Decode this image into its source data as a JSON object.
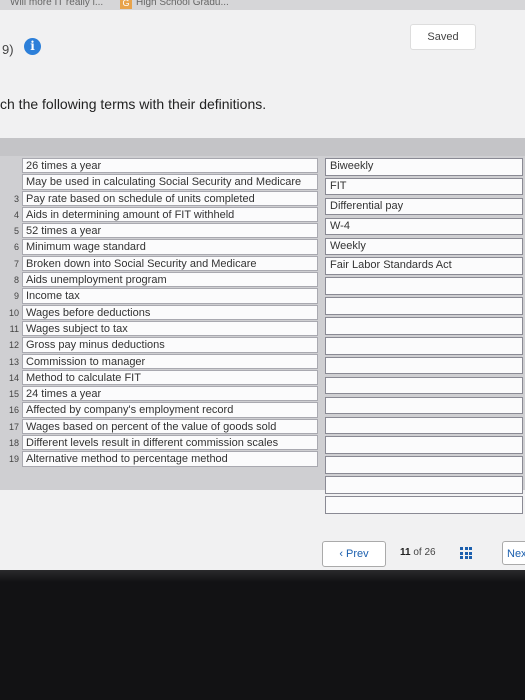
{
  "browser": {
    "tabs": [
      {
        "label": "Will more IT really i..."
      },
      {
        "label": "High School Gradu..."
      }
    ]
  },
  "header": {
    "saved_label": "Saved",
    "question_number": "9)",
    "info_icon": "i"
  },
  "instructions": "ch the following terms with their definitions.",
  "terms": [
    {
      "num": "",
      "text": "26 times a year"
    },
    {
      "num": "",
      "text": "May be used in calculating Social Security and Medicare"
    },
    {
      "num": "3",
      "text": "Pay rate based on schedule of units completed"
    },
    {
      "num": "4",
      "text": "Aids in determining amount of FIT withheld"
    },
    {
      "num": "5",
      "text": "52 times a year"
    },
    {
      "num": "6",
      "text": "Minimum wage standard"
    },
    {
      "num": "7",
      "text": "Broken down into Social Security and Medicare"
    },
    {
      "num": "8",
      "text": "Aids unemployment program"
    },
    {
      "num": "9",
      "text": "Income tax"
    },
    {
      "num": "10",
      "text": "Wages before deductions"
    },
    {
      "num": "11",
      "text": "Wages subject to tax"
    },
    {
      "num": "12",
      "text": "Gross pay minus deductions"
    },
    {
      "num": "13",
      "text": "Commission to manager"
    },
    {
      "num": "14",
      "text": "Method to calculate FIT"
    },
    {
      "num": "15",
      "text": "24 times a year"
    },
    {
      "num": "16",
      "text": "Affected by company's employment record"
    },
    {
      "num": "17",
      "text": "Wages based on percent of the value of goods sold"
    },
    {
      "num": "18",
      "text": "Different levels result in different commission scales"
    },
    {
      "num": "19",
      "text": "Alternative method to percentage method"
    }
  ],
  "answers": [
    "Biweekly",
    "FIT",
    "Differential pay",
    "W-4",
    "Weekly",
    "Fair Labor Standards Act",
    "",
    "",
    "",
    "",
    "",
    "",
    "",
    "",
    "",
    "",
    "",
    ""
  ],
  "pagination": {
    "prev_label": "Prev",
    "current": "11",
    "of_label": "of",
    "total": "26",
    "next_label": "Next"
  },
  "colors": {
    "accent": "#2c7fd9",
    "link": "#1b5fae"
  }
}
